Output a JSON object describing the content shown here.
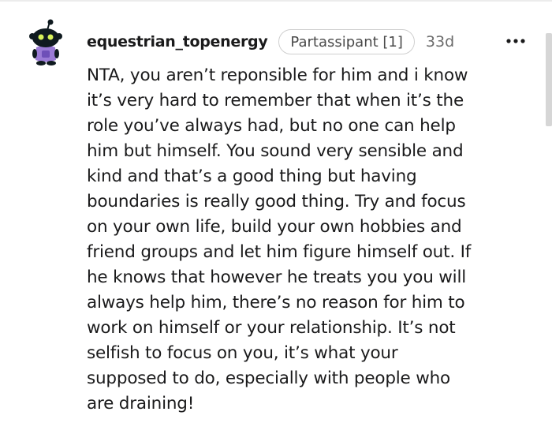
{
  "comment": {
    "author": "equestrian_topenergy",
    "flair": "Partassipant [1]",
    "age": "33d",
    "more_label": "•••",
    "body_lines": [
      "NTA, you aren’t reponsible for him and i know",
      "it’s very hard to remember that when it’s the",
      "role you’ve always had, but no one can help",
      "him but himself. You sound very sensible and",
      "kind and that’s a good thing but having",
      "boundaries is really good thing. Try and focus",
      "on your own life, build your own hobbies and",
      "friend groups and let him figure himself out. If",
      "he knows that however he treats you you will",
      "always help him, there’s no reason for him to",
      "work on himself or your relationship. It’s not",
      "selfish to focus on you, it’s what your",
      "supposed to do, especially with people who",
      "are draining!"
    ]
  },
  "icons": {
    "avatar": "snoo-avatar-icon",
    "more": "more-options-icon"
  },
  "colors": {
    "text": "#1a1a1b",
    "meta": "#6b6b6b",
    "flair_border": "#cfcfcf",
    "avatar_head": "#0f1a1f",
    "avatar_eyes": "#d7f25a",
    "avatar_body": "#9b7bd6"
  }
}
